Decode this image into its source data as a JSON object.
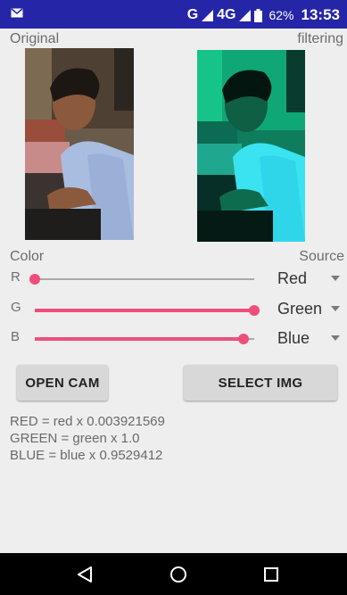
{
  "status_bar": {
    "network": "G",
    "network2": "4G",
    "battery": "62%",
    "time": "13:53"
  },
  "labels": {
    "original": "Original",
    "filtering": "filtering",
    "color": "Color",
    "source": "Source"
  },
  "channels": [
    {
      "letter": "R",
      "source": "Red",
      "level": 0.0
    },
    {
      "letter": "G",
      "source": "Green",
      "level": 1.0
    },
    {
      "letter": "B",
      "source": "Blue",
      "level": 0.953
    }
  ],
  "buttons": {
    "open_cam": "OPEN CAM",
    "select_img": "SELECT IMG"
  },
  "formulas": [
    "RED = red x 0.003921569",
    "GREEN = green x 1.0",
    "BLUE = blue x 0.9529412"
  ],
  "colors": {
    "status_bar": "#2525a7",
    "accent": "#ef4e7b"
  }
}
